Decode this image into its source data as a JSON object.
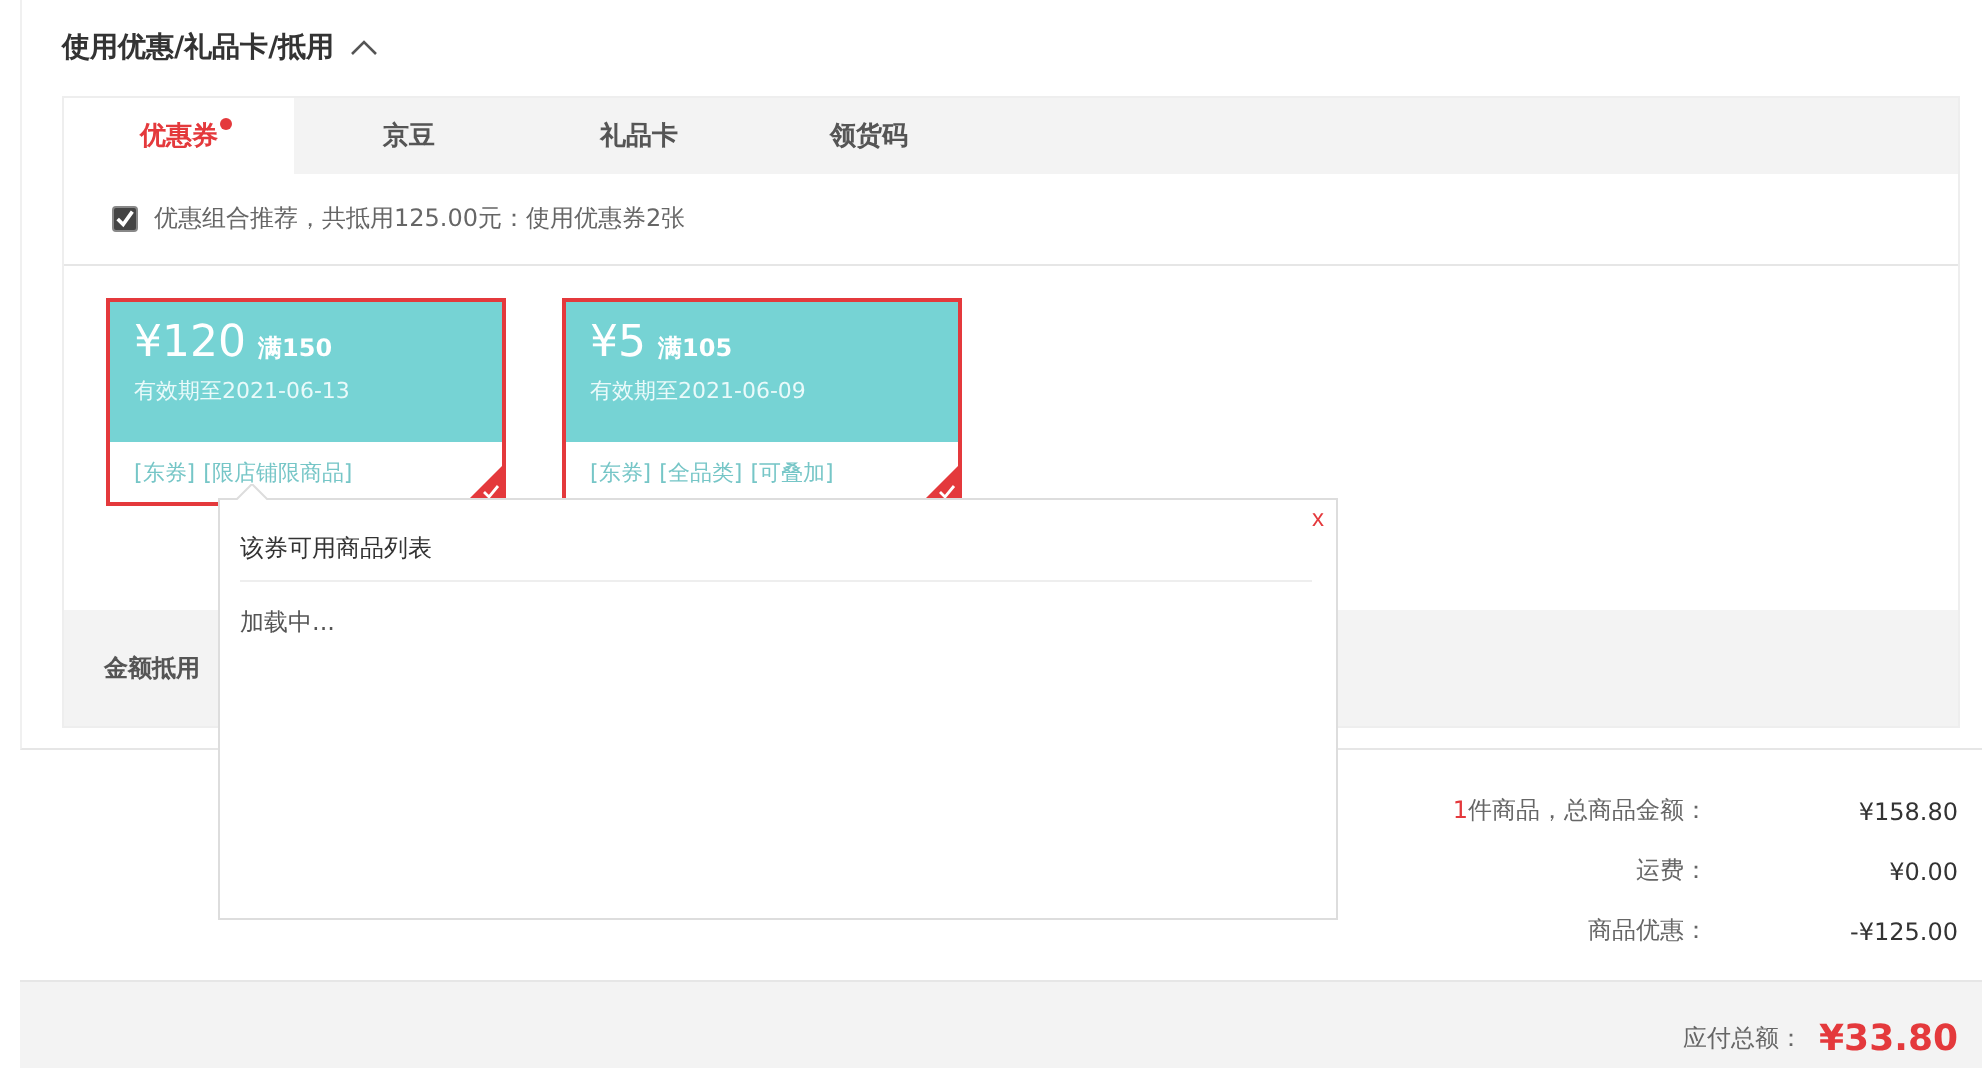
{
  "section": {
    "title": "使用优惠/礼品卡/抵用",
    "expanded": true
  },
  "tabs": [
    {
      "label": "优惠券",
      "selected": true,
      "dot": true
    },
    {
      "label": "京豆",
      "selected": false,
      "dot": false
    },
    {
      "label": "礼品卡",
      "selected": false,
      "dot": false
    },
    {
      "label": "领货码",
      "selected": false,
      "dot": false
    }
  ],
  "recommend": {
    "checked": true,
    "text": "优惠组合推荐，共抵用125.00元：使用优惠券2张"
  },
  "coupons": [
    {
      "amount": "¥120",
      "condition": "满150",
      "expiry": "有效期至2021-06-13",
      "tags": [
        "[东券]",
        "[限店铺限商品]"
      ],
      "selected": true
    },
    {
      "amount": "¥5",
      "condition": "满105",
      "expiry": "有效期至2021-06-09",
      "tags": [
        "[东券]",
        "[全品类]",
        "[可叠加]"
      ],
      "selected": true
    }
  ],
  "deduction": {
    "label": "金额抵用"
  },
  "popup": {
    "title": "该券可用商品列表",
    "close": "x",
    "body": "加载中..."
  },
  "summary": [
    {
      "count": "1",
      "label": "件商品，总商品金额：",
      "value": "¥158.80"
    },
    {
      "label": "运费：",
      "value": "¥0.00"
    },
    {
      "label": "商品优惠：",
      "value": "-¥125.00"
    }
  ],
  "total": {
    "label": "应付总额：",
    "value": "¥33.80"
  }
}
